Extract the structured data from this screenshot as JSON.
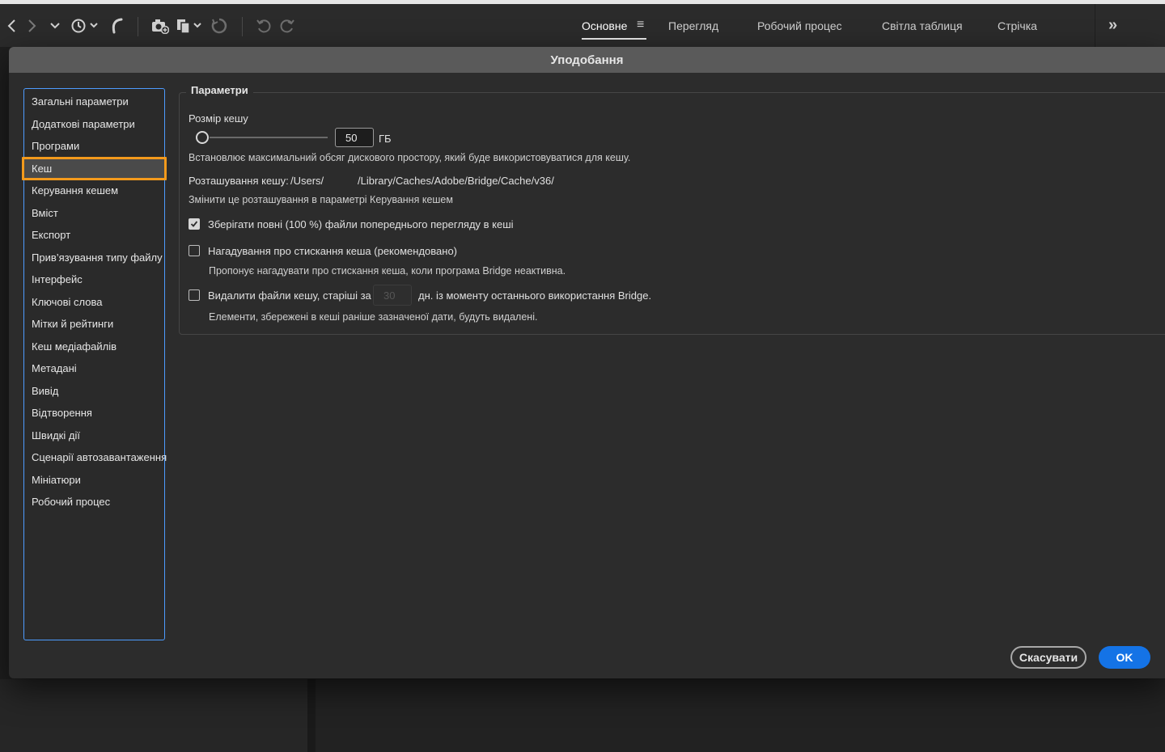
{
  "toolbar": {
    "icons": [
      "back-icon",
      "forward-icon",
      "chevron-down-icon",
      "recent-history-icon",
      "boomerang-icon",
      "camera-get-photos-icon",
      "copy-files-icon",
      "refine-icon",
      "rotate-left-icon",
      "rotate-right-icon",
      "more-workspaces-icon"
    ],
    "workspaces": [
      {
        "label": "Основне",
        "active": true
      },
      {
        "label": "Перегляд",
        "active": false
      },
      {
        "label": "Робочий процес",
        "active": false
      },
      {
        "label": "Світла таблиця",
        "active": false
      },
      {
        "label": "Стрічка",
        "active": false
      }
    ],
    "more_label": "»"
  },
  "dialog": {
    "title": "Уподобання",
    "categories": [
      {
        "label": "Загальні параметри",
        "selected": false
      },
      {
        "label": "Додаткові параметри",
        "selected": false
      },
      {
        "label": "Програми",
        "selected": false
      },
      {
        "label": "Кеш",
        "selected": true
      },
      {
        "label": "Керування кешем",
        "selected": false
      },
      {
        "label": "Вміст",
        "selected": false
      },
      {
        "label": "Експорт",
        "selected": false
      },
      {
        "label": "Прив’язування типу файлу",
        "selected": false
      },
      {
        "label": "Інтерфейс",
        "selected": false
      },
      {
        "label": "Ключові слова",
        "selected": false
      },
      {
        "label": "Мітки й рейтинги",
        "selected": false
      },
      {
        "label": "Кеш медіафайлів",
        "selected": false
      },
      {
        "label": "Метадані",
        "selected": false
      },
      {
        "label": "Вивід",
        "selected": false
      },
      {
        "label": "Відтворення",
        "selected": false
      },
      {
        "label": "Швидкі дії",
        "selected": false
      },
      {
        "label": "Сценарії автозавантаження",
        "selected": false
      },
      {
        "label": "Мініатюри",
        "selected": false
      },
      {
        "label": "Робочий процес",
        "selected": false
      }
    ],
    "group_title": "Параметри",
    "cache_size": {
      "label": "Розмір кешу",
      "value": "50",
      "unit": "ГБ",
      "slider_level": 0.0,
      "description": "Встановлює максимальний обсяг дискового простору, який буде використовуватися для кешу."
    },
    "cache_location": {
      "label": "Розташування кешу:",
      "path_start": "/Users/",
      "path_end": "/Library/Caches/Adobe/Bridge/Cache/v36/",
      "hint": "Змінити це розташування в параметрі Керування кешем"
    },
    "options": {
      "keep_full_previews": {
        "label": "Зберігати повні (100 %) файли попереднього перегляду в кеші",
        "checked": true
      },
      "compact_reminder": {
        "label": "Нагадування про стискання кеша (рекомендовано)",
        "checked": false,
        "hint": "Пропонує нагадувати про стискання кеша, коли програма Bridge неактивна."
      },
      "delete_old": {
        "label_before": "Видалити файли кешу, старіші за",
        "days_value": "30",
        "label_after": "дн. із моменту останнього використання Bridge.",
        "checked": false,
        "hint": "Елементи, збережені в кеші раніше зазначеної дати, будуть видалені."
      }
    },
    "buttons": {
      "cancel": "Скасувати",
      "ok": "OK"
    },
    "colors": {
      "accent_blue": "#1473e6",
      "highlight_orange": "#f39a1c",
      "focus_blue": "#4d9cff"
    }
  }
}
